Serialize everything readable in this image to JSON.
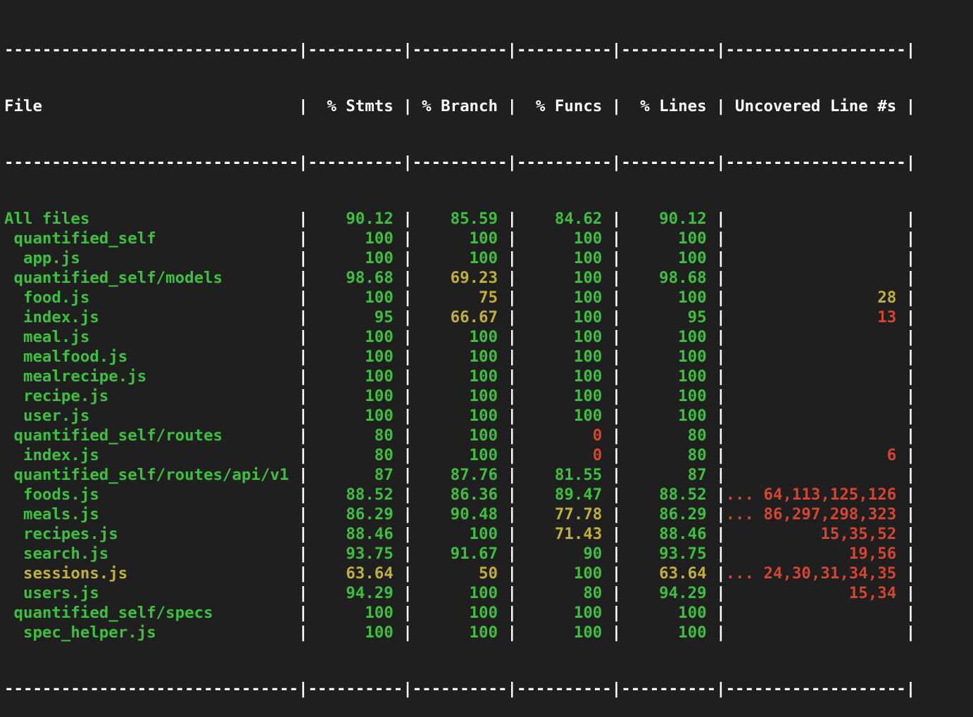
{
  "colors": {
    "background": "#1f1f1f",
    "text": "#ffffff",
    "green": "#3dc03d",
    "yellow": "#c0b03a",
    "red": "#d64530"
  },
  "header": {
    "file": "File",
    "stmts": "% Stmts",
    "branch": "% Branch",
    "funcs": "% Funcs",
    "lines": "% Lines",
    "uncovered": "Uncovered Line #s"
  },
  "rows": [
    {
      "file": "All files",
      "indent": 0,
      "file_status": "green",
      "stmts": "90.12",
      "stmts_status": "green",
      "branch": "85.59",
      "branch_status": "green",
      "funcs": "84.62",
      "funcs_status": "green",
      "lines": "90.12",
      "lines_status": "green",
      "uncovered": "",
      "uncovered_status": "red"
    },
    {
      "file": "quantified_self",
      "indent": 1,
      "file_status": "green",
      "stmts": "100",
      "stmts_status": "green",
      "branch": "100",
      "branch_status": "green",
      "funcs": "100",
      "funcs_status": "green",
      "lines": "100",
      "lines_status": "green",
      "uncovered": "",
      "uncovered_status": "red"
    },
    {
      "file": "app.js",
      "indent": 2,
      "file_status": "green",
      "stmts": "100",
      "stmts_status": "green",
      "branch": "100",
      "branch_status": "green",
      "funcs": "100",
      "funcs_status": "green",
      "lines": "100",
      "lines_status": "green",
      "uncovered": "",
      "uncovered_status": "red"
    },
    {
      "file": "quantified_self/models",
      "indent": 1,
      "file_status": "green",
      "stmts": "98.68",
      "stmts_status": "green",
      "branch": "69.23",
      "branch_status": "yellow",
      "funcs": "100",
      "funcs_status": "green",
      "lines": "98.68",
      "lines_status": "green",
      "uncovered": "",
      "uncovered_status": "red"
    },
    {
      "file": "food.js",
      "indent": 2,
      "file_status": "green",
      "stmts": "100",
      "stmts_status": "green",
      "branch": "75",
      "branch_status": "yellow",
      "funcs": "100",
      "funcs_status": "green",
      "lines": "100",
      "lines_status": "green",
      "uncovered": "28",
      "uncovered_status": "yellow"
    },
    {
      "file": "index.js",
      "indent": 2,
      "file_status": "green",
      "stmts": "95",
      "stmts_status": "green",
      "branch": "66.67",
      "branch_status": "yellow",
      "funcs": "100",
      "funcs_status": "green",
      "lines": "95",
      "lines_status": "green",
      "uncovered": "13",
      "uncovered_status": "red"
    },
    {
      "file": "meal.js",
      "indent": 2,
      "file_status": "green",
      "stmts": "100",
      "stmts_status": "green",
      "branch": "100",
      "branch_status": "green",
      "funcs": "100",
      "funcs_status": "green",
      "lines": "100",
      "lines_status": "green",
      "uncovered": "",
      "uncovered_status": "red"
    },
    {
      "file": "mealfood.js",
      "indent": 2,
      "file_status": "green",
      "stmts": "100",
      "stmts_status": "green",
      "branch": "100",
      "branch_status": "green",
      "funcs": "100",
      "funcs_status": "green",
      "lines": "100",
      "lines_status": "green",
      "uncovered": "",
      "uncovered_status": "red"
    },
    {
      "file": "mealrecipe.js",
      "indent": 2,
      "file_status": "green",
      "stmts": "100",
      "stmts_status": "green",
      "branch": "100",
      "branch_status": "green",
      "funcs": "100",
      "funcs_status": "green",
      "lines": "100",
      "lines_status": "green",
      "uncovered": "",
      "uncovered_status": "red"
    },
    {
      "file": "recipe.js",
      "indent": 2,
      "file_status": "green",
      "stmts": "100",
      "stmts_status": "green",
      "branch": "100",
      "branch_status": "green",
      "funcs": "100",
      "funcs_status": "green",
      "lines": "100",
      "lines_status": "green",
      "uncovered": "",
      "uncovered_status": "red"
    },
    {
      "file": "user.js",
      "indent": 2,
      "file_status": "green",
      "stmts": "100",
      "stmts_status": "green",
      "branch": "100",
      "branch_status": "green",
      "funcs": "100",
      "funcs_status": "green",
      "lines": "100",
      "lines_status": "green",
      "uncovered": "",
      "uncovered_status": "red"
    },
    {
      "file": "quantified_self/routes",
      "indent": 1,
      "file_status": "green",
      "stmts": "80",
      "stmts_status": "green",
      "branch": "100",
      "branch_status": "green",
      "funcs": "0",
      "funcs_status": "red",
      "lines": "80",
      "lines_status": "green",
      "uncovered": "",
      "uncovered_status": "red"
    },
    {
      "file": "index.js",
      "indent": 2,
      "file_status": "green",
      "stmts": "80",
      "stmts_status": "green",
      "branch": "100",
      "branch_status": "green",
      "funcs": "0",
      "funcs_status": "red",
      "lines": "80",
      "lines_status": "green",
      "uncovered": "6",
      "uncovered_status": "red"
    },
    {
      "file": "quantified_self/routes/api/v1",
      "indent": 1,
      "file_status": "green",
      "stmts": "87",
      "stmts_status": "green",
      "branch": "87.76",
      "branch_status": "green",
      "funcs": "81.55",
      "funcs_status": "green",
      "lines": "87",
      "lines_status": "green",
      "uncovered": "",
      "uncovered_status": "red"
    },
    {
      "file": "foods.js",
      "indent": 2,
      "file_status": "green",
      "stmts": "88.52",
      "stmts_status": "green",
      "branch": "86.36",
      "branch_status": "green",
      "funcs": "89.47",
      "funcs_status": "green",
      "lines": "88.52",
      "lines_status": "green",
      "uncovered": "... 64,113,125,126",
      "uncovered_status": "red"
    },
    {
      "file": "meals.js",
      "indent": 2,
      "file_status": "green",
      "stmts": "86.29",
      "stmts_status": "green",
      "branch": "90.48",
      "branch_status": "green",
      "funcs": "77.78",
      "funcs_status": "yellow",
      "lines": "86.29",
      "lines_status": "green",
      "uncovered": "... 86,297,298,323",
      "uncovered_status": "red"
    },
    {
      "file": "recipes.js",
      "indent": 2,
      "file_status": "green",
      "stmts": "88.46",
      "stmts_status": "green",
      "branch": "100",
      "branch_status": "green",
      "funcs": "71.43",
      "funcs_status": "yellow",
      "lines": "88.46",
      "lines_status": "green",
      "uncovered": "15,35,52",
      "uncovered_status": "red"
    },
    {
      "file": "search.js",
      "indent": 2,
      "file_status": "green",
      "stmts": "93.75",
      "stmts_status": "green",
      "branch": "91.67",
      "branch_status": "green",
      "funcs": "90",
      "funcs_status": "green",
      "lines": "93.75",
      "lines_status": "green",
      "uncovered": "19,56",
      "uncovered_status": "red"
    },
    {
      "file": "sessions.js",
      "indent": 2,
      "file_status": "yellow",
      "stmts": "63.64",
      "stmts_status": "yellow",
      "branch": "50",
      "branch_status": "yellow",
      "funcs": "100",
      "funcs_status": "green",
      "lines": "63.64",
      "lines_status": "yellow",
      "uncovered": "... 24,30,31,34,35",
      "uncovered_status": "red"
    },
    {
      "file": "users.js",
      "indent": 2,
      "file_status": "green",
      "stmts": "94.29",
      "stmts_status": "green",
      "branch": "100",
      "branch_status": "green",
      "funcs": "80",
      "funcs_status": "green",
      "lines": "94.29",
      "lines_status": "green",
      "uncovered": "15,34",
      "uncovered_status": "red"
    },
    {
      "file": "quantified_self/specs",
      "indent": 1,
      "file_status": "green",
      "stmts": "100",
      "stmts_status": "green",
      "branch": "100",
      "branch_status": "green",
      "funcs": "100",
      "funcs_status": "green",
      "lines": "100",
      "lines_status": "green",
      "uncovered": "",
      "uncovered_status": "red"
    },
    {
      "file": "spec_helper.js",
      "indent": 2,
      "file_status": "green",
      "stmts": "100",
      "stmts_status": "green",
      "branch": "100",
      "branch_status": "green",
      "funcs": "100",
      "funcs_status": "green",
      "lines": "100",
      "lines_status": "green",
      "uncovered": "",
      "uncovered_status": "red"
    }
  ]
}
